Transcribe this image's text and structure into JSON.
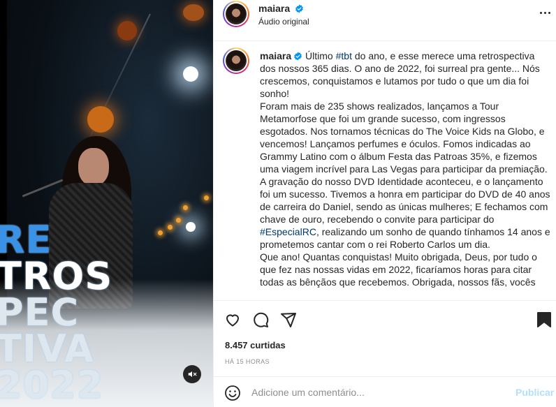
{
  "media": {
    "overlay_text": [
      "RE",
      "TROS",
      "PEC",
      "TIVA",
      "2022"
    ],
    "mute_icon": "speaker-muted-icon"
  },
  "header": {
    "username": "maiara",
    "subtitle": "Áudio original",
    "more_icon": "more-options-icon"
  },
  "caption": {
    "username": "maiara",
    "segments": [
      {
        "text": "Último ",
        "tag": false
      },
      {
        "text": "#tbt",
        "tag": true
      },
      {
        "text": " do ano, e esse merece uma retrospectiva dos nossos 365 dias. O ano de 2022, foi surreal pra gente... Nós crescemos, conquistamos e lutamos por tudo o que um dia foi sonho!\nForam mais de 235 shows realizados, lançamos a Tour Metamorfose que foi um grande sucesso, com ingressos esgotados. Nos tornamos técnicas do The Voice Kids na Globo, e vencemos! Lançamos perfumes e óculos. Fomos indicadas ao Grammy Latino com o álbum Festa das Patroas 35%, e fizemos uma viagem incrível para Las Vegas para participar da premiação. A gravação do nosso DVD Identidade aconteceu, e o lançamento foi um sucesso. Tivemos a honra em participar do DVD de 40 anos de carreira do Daniel, sendo as únicas mulheres; E fechamos com chave de ouro, recebendo o convite para participar do ",
        "tag": false
      },
      {
        "text": "#EspecialRC",
        "tag": true
      },
      {
        "text": ", realizando um sonho de quando tínhamos 14 anos e prometemos cantar com o rei Roberto Carlos um dia.\nQue ano! Quantas conquistas! Muito obrigada, Deus, por tudo o que fez nas nossas vidas em 2022, ficaríamos horas para citar todas as bênçãos que recebemos. Obrigada, nossos fãs, vocês",
        "tag": false
      }
    ]
  },
  "actions": {
    "like_icon": "heart-icon",
    "comment_icon": "comment-icon",
    "share_icon": "share-icon",
    "save_icon": "bookmark-icon",
    "likes_count": "8.457",
    "likes_label": "curtidas",
    "time": "HÁ 15 HORAS"
  },
  "comment": {
    "emoji_icon": "emoji-icon",
    "placeholder": "Adicione um comentário...",
    "publish_label": "Publicar"
  },
  "colors": {
    "link": "#00376b",
    "publish_disabled": "#b2dffc",
    "verified": "#0095f6",
    "muted_text": "#8e8e8e"
  }
}
